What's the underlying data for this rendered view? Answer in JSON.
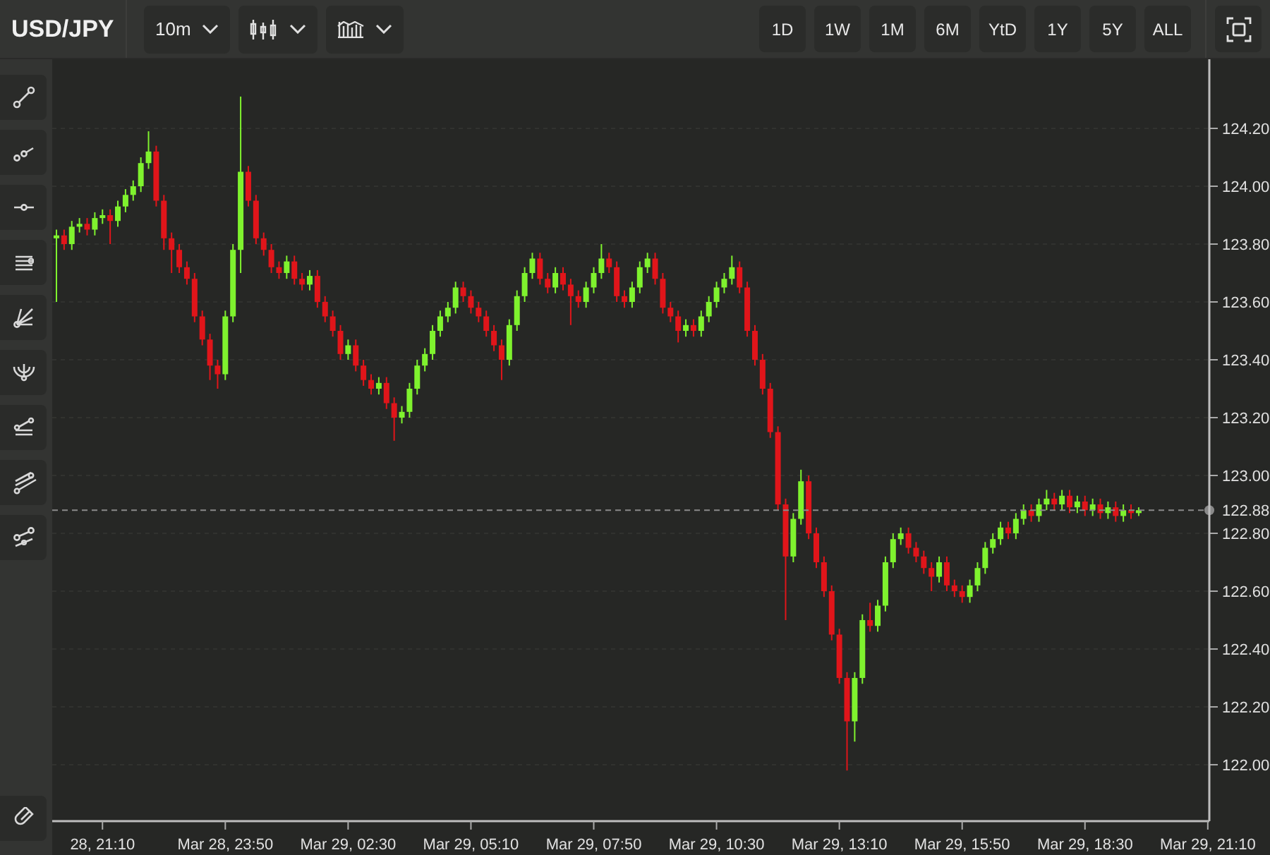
{
  "header": {
    "symbol": "USD/JPY",
    "interval": "10m",
    "ranges": [
      {
        "label": "1D",
        "selected": false
      },
      {
        "label": "1W",
        "selected": false
      },
      {
        "label": "1M",
        "selected": false
      },
      {
        "label": "6M",
        "selected": false
      },
      {
        "label": "YtD",
        "selected": false
      },
      {
        "label": "1Y",
        "selected": false
      },
      {
        "label": "5Y",
        "selected": false
      },
      {
        "label": "ALL",
        "selected": false
      }
    ]
  },
  "chart": {
    "chart_data": {
      "type": "candlestick",
      "categories": [
        null,
        null,
        null,
        null,
        null,
        null,
        "28, 21:10",
        null,
        null,
        null,
        null,
        null,
        null,
        null,
        null,
        null,
        null,
        null,
        null,
        null,
        null,
        null,
        "Mar 28, 23:50",
        null,
        null,
        null,
        null,
        null,
        null,
        null,
        null,
        null,
        null,
        null,
        null,
        null,
        null,
        null,
        "Mar 29, 02:30",
        null,
        null,
        null,
        null,
        null,
        null,
        null,
        null,
        null,
        null,
        null,
        null,
        null,
        null,
        null,
        "Mar 29, 05:10",
        null,
        null,
        null,
        null,
        null,
        null,
        null,
        null,
        null,
        null,
        null,
        null,
        null,
        null,
        null,
        "Mar 29, 07:50",
        null,
        null,
        null,
        null,
        null,
        null,
        null,
        null,
        null,
        null,
        null,
        null,
        null,
        null,
        null,
        "Mar 29, 10:30",
        null,
        null,
        null,
        null,
        null,
        null,
        null,
        null,
        null,
        null,
        null,
        null,
        null,
        null,
        null,
        "Mar 29, 13:10",
        null,
        null,
        null,
        null,
        null,
        null,
        null,
        null,
        null,
        null,
        null,
        null,
        null,
        null,
        null,
        "Mar 29, 15:50",
        null,
        null,
        null,
        null,
        null,
        null,
        null,
        null,
        null,
        null,
        null,
        null,
        null,
        null,
        null,
        "Mar 29, 18:30",
        null,
        null,
        null,
        null,
        null,
        null,
        null,
        null,
        null,
        null,
        null,
        null,
        null,
        null,
        null,
        "Mar 29, 21:10"
      ],
      "ohlc": [
        [
          123.82,
          123.85,
          123.6,
          123.83
        ],
        [
          123.83,
          123.85,
          123.78,
          123.8
        ],
        [
          123.8,
          123.88,
          123.78,
          123.86
        ],
        [
          123.86,
          123.89,
          123.84,
          123.87
        ],
        [
          123.87,
          123.89,
          123.83,
          123.85
        ],
        [
          123.85,
          123.91,
          123.83,
          123.89
        ],
        [
          123.89,
          123.92,
          123.87,
          123.9
        ],
        [
          123.9,
          123.92,
          123.8,
          123.88
        ],
        [
          123.88,
          123.95,
          123.86,
          123.93
        ],
        [
          123.93,
          123.99,
          123.91,
          123.97
        ],
        [
          123.97,
          124.02,
          123.95,
          124.0
        ],
        [
          124.0,
          124.1,
          123.98,
          124.08
        ],
        [
          124.08,
          124.19,
          124.06,
          124.12
        ],
        [
          124.12,
          124.14,
          123.93,
          123.95
        ],
        [
          123.95,
          123.97,
          123.78,
          123.82
        ],
        [
          123.82,
          123.84,
          123.7,
          123.78
        ],
        [
          123.78,
          123.8,
          123.7,
          123.72
        ],
        [
          123.72,
          123.74,
          123.66,
          123.68
        ],
        [
          123.68,
          123.7,
          123.53,
          123.55
        ],
        [
          123.55,
          123.57,
          123.45,
          123.47
        ],
        [
          123.47,
          123.49,
          123.33,
          123.38
        ],
        [
          123.38,
          123.4,
          123.3,
          123.35
        ],
        [
          123.35,
          123.57,
          123.33,
          123.55
        ],
        [
          123.55,
          123.8,
          123.53,
          123.78
        ],
        [
          123.78,
          124.31,
          123.7,
          124.05
        ],
        [
          124.05,
          124.07,
          123.93,
          123.95
        ],
        [
          123.95,
          123.97,
          123.8,
          123.82
        ],
        [
          123.82,
          123.84,
          123.76,
          123.78
        ],
        [
          123.78,
          123.8,
          123.7,
          123.72
        ],
        [
          123.72,
          123.74,
          123.68,
          123.7
        ],
        [
          123.7,
          123.76,
          123.68,
          123.74
        ],
        [
          123.74,
          123.76,
          123.66,
          123.68
        ],
        [
          123.68,
          123.7,
          123.64,
          123.66
        ],
        [
          123.66,
          123.71,
          123.64,
          123.69
        ],
        [
          123.69,
          123.71,
          123.58,
          123.6
        ],
        [
          123.6,
          123.62,
          123.53,
          123.55
        ],
        [
          123.55,
          123.57,
          123.48,
          123.5
        ],
        [
          123.5,
          123.52,
          123.4,
          123.42
        ],
        [
          123.42,
          123.47,
          123.4,
          123.45
        ],
        [
          123.45,
          123.47,
          123.36,
          123.38
        ],
        [
          123.38,
          123.4,
          123.31,
          123.33
        ],
        [
          123.33,
          123.35,
          123.28,
          123.3
        ],
        [
          123.3,
          123.34,
          123.28,
          123.32
        ],
        [
          123.32,
          123.34,
          123.23,
          123.25
        ],
        [
          123.25,
          123.27,
          123.12,
          123.2
        ],
        [
          123.2,
          123.24,
          123.18,
          123.22
        ],
        [
          123.22,
          123.32,
          123.2,
          123.3
        ],
        [
          123.3,
          123.4,
          123.28,
          123.38
        ],
        [
          123.38,
          123.44,
          123.36,
          123.42
        ],
        [
          123.42,
          123.52,
          123.4,
          123.5
        ],
        [
          123.5,
          123.57,
          123.48,
          123.55
        ],
        [
          123.55,
          123.6,
          123.53,
          123.58
        ],
        [
          123.58,
          123.67,
          123.56,
          123.65
        ],
        [
          123.65,
          123.67,
          123.6,
          123.62
        ],
        [
          123.62,
          123.64,
          123.56,
          123.58
        ],
        [
          123.58,
          123.6,
          123.53,
          123.55
        ],
        [
          123.55,
          123.57,
          123.48,
          123.5
        ],
        [
          123.5,
          123.52,
          123.43,
          123.45
        ],
        [
          123.45,
          123.47,
          123.33,
          123.4
        ],
        [
          123.4,
          123.54,
          123.38,
          123.52
        ],
        [
          123.52,
          123.64,
          123.5,
          123.62
        ],
        [
          123.62,
          123.72,
          123.6,
          123.7
        ],
        [
          123.7,
          123.77,
          123.68,
          123.75
        ],
        [
          123.75,
          123.77,
          123.66,
          123.68
        ],
        [
          123.68,
          123.7,
          123.63,
          123.65
        ],
        [
          123.65,
          123.72,
          123.63,
          123.7
        ],
        [
          123.7,
          123.72,
          123.64,
          123.66
        ],
        [
          123.66,
          123.68,
          123.52,
          123.62
        ],
        [
          123.62,
          123.64,
          123.58,
          123.6
        ],
        [
          123.6,
          123.67,
          123.58,
          123.65
        ],
        [
          123.65,
          123.72,
          123.63,
          123.7
        ],
        [
          123.7,
          123.8,
          123.68,
          123.75
        ],
        [
          123.75,
          123.77,
          123.7,
          123.72
        ],
        [
          123.72,
          123.74,
          123.6,
          123.62
        ],
        [
          123.62,
          123.64,
          123.58,
          123.6
        ],
        [
          123.6,
          123.67,
          123.58,
          123.65
        ],
        [
          123.65,
          123.74,
          123.63,
          123.72
        ],
        [
          123.72,
          123.77,
          123.7,
          123.75
        ],
        [
          123.75,
          123.77,
          123.66,
          123.68
        ],
        [
          123.68,
          123.7,
          123.56,
          123.58
        ],
        [
          123.58,
          123.6,
          123.53,
          123.55
        ],
        [
          123.55,
          123.57,
          123.46,
          123.5
        ],
        [
          123.5,
          123.54,
          123.48,
          123.52
        ],
        [
          123.52,
          123.54,
          123.48,
          123.5
        ],
        [
          123.5,
          123.57,
          123.48,
          123.55
        ],
        [
          123.55,
          123.62,
          123.53,
          123.6
        ],
        [
          123.6,
          123.67,
          123.58,
          123.65
        ],
        [
          123.65,
          123.7,
          123.63,
          123.68
        ],
        [
          123.68,
          123.76,
          123.66,
          123.72
        ],
        [
          123.72,
          123.74,
          123.63,
          123.65
        ],
        [
          123.65,
          123.67,
          123.48,
          123.5
        ],
        [
          123.5,
          123.52,
          123.38,
          123.4
        ],
        [
          123.4,
          123.42,
          123.28,
          123.3
        ],
        [
          123.3,
          123.32,
          123.13,
          123.15
        ],
        [
          123.15,
          123.17,
          122.88,
          122.9
        ],
        [
          122.9,
          122.92,
          122.5,
          122.72
        ],
        [
          122.72,
          122.87,
          122.7,
          122.85
        ],
        [
          122.85,
          123.02,
          122.83,
          122.98
        ],
        [
          122.98,
          123.0,
          122.78,
          122.8
        ],
        [
          122.8,
          122.82,
          122.68,
          122.7
        ],
        [
          122.7,
          122.72,
          122.58,
          122.6
        ],
        [
          122.6,
          122.62,
          122.43,
          122.45
        ],
        [
          122.45,
          122.47,
          122.28,
          122.3
        ],
        [
          122.3,
          122.32,
          121.98,
          122.15
        ],
        [
          122.15,
          122.32,
          122.08,
          122.3
        ],
        [
          122.3,
          122.52,
          122.28,
          122.5
        ],
        [
          122.5,
          122.56,
          122.46,
          122.48
        ],
        [
          122.48,
          122.57,
          122.46,
          122.55
        ],
        [
          122.55,
          122.72,
          122.53,
          122.7
        ],
        [
          122.7,
          122.8,
          122.68,
          122.78
        ],
        [
          122.78,
          122.82,
          122.76,
          122.8
        ],
        [
          122.8,
          122.82,
          122.73,
          122.75
        ],
        [
          122.75,
          122.77,
          122.7,
          122.72
        ],
        [
          122.72,
          122.74,
          122.66,
          122.68
        ],
        [
          122.68,
          122.7,
          122.6,
          122.65
        ],
        [
          122.65,
          122.72,
          122.63,
          122.7
        ],
        [
          122.7,
          122.72,
          122.6,
          122.62
        ],
        [
          122.62,
          122.64,
          122.58,
          122.6
        ],
        [
          122.6,
          122.62,
          122.56,
          122.58
        ],
        [
          122.58,
          122.64,
          122.56,
          122.62
        ],
        [
          122.62,
          122.7,
          122.6,
          122.68
        ],
        [
          122.68,
          122.77,
          122.66,
          122.75
        ],
        [
          122.75,
          122.8,
          122.73,
          122.78
        ],
        [
          122.78,
          122.84,
          122.76,
          122.82
        ],
        [
          122.82,
          122.84,
          122.78,
          122.8
        ],
        [
          122.8,
          122.87,
          122.78,
          122.85
        ],
        [
          122.85,
          122.9,
          122.83,
          122.88
        ],
        [
          122.88,
          122.9,
          122.84,
          122.86
        ],
        [
          122.86,
          122.92,
          122.84,
          122.9
        ],
        [
          122.9,
          122.95,
          122.88,
          122.92
        ],
        [
          122.92,
          122.94,
          122.88,
          122.9
        ],
        [
          122.9,
          122.95,
          122.88,
          122.93
        ],
        [
          122.93,
          122.95,
          122.87,
          122.89
        ],
        [
          122.89,
          122.93,
          122.87,
          122.91
        ],
        [
          122.91,
          122.93,
          122.86,
          122.88
        ],
        [
          122.88,
          122.92,
          122.86,
          122.9
        ],
        [
          122.9,
          122.92,
          122.85,
          122.87
        ],
        [
          122.87,
          122.91,
          122.85,
          122.89
        ],
        [
          122.89,
          122.91,
          122.84,
          122.86
        ],
        [
          122.86,
          122.9,
          122.84,
          122.88
        ],
        [
          122.88,
          122.9,
          122.85,
          122.87
        ],
        [
          122.87,
          122.89,
          122.86,
          122.88
        ],
        null,
        null,
        null,
        null,
        null,
        null,
        null,
        null,
        null
      ],
      "ylim": [
        121.805,
        124.439
      ],
      "yticks": [
        {
          "value": 124.2,
          "label": "124.20"
        },
        {
          "value": 124.0,
          "label": "124.00"
        },
        {
          "value": 123.8,
          "label": "123.80"
        },
        {
          "value": 123.6,
          "label": "123.60"
        },
        {
          "value": 123.4,
          "label": "123.40"
        },
        {
          "value": 123.2,
          "label": "123.20"
        },
        {
          "value": 123.0,
          "label": "123.00"
        },
        {
          "value": 122.8,
          "label": "122.80"
        },
        {
          "value": 122.6,
          "label": "122.60"
        },
        {
          "value": 122.4,
          "label": "122.40"
        },
        {
          "value": 122.2,
          "label": "122.20"
        },
        {
          "value": 122.0,
          "label": "122.00"
        }
      ],
      "grid": true,
      "ref_lines": [
        {
          "axis": "y",
          "value": 122.88,
          "label": "122.88"
        }
      ]
    }
  }
}
